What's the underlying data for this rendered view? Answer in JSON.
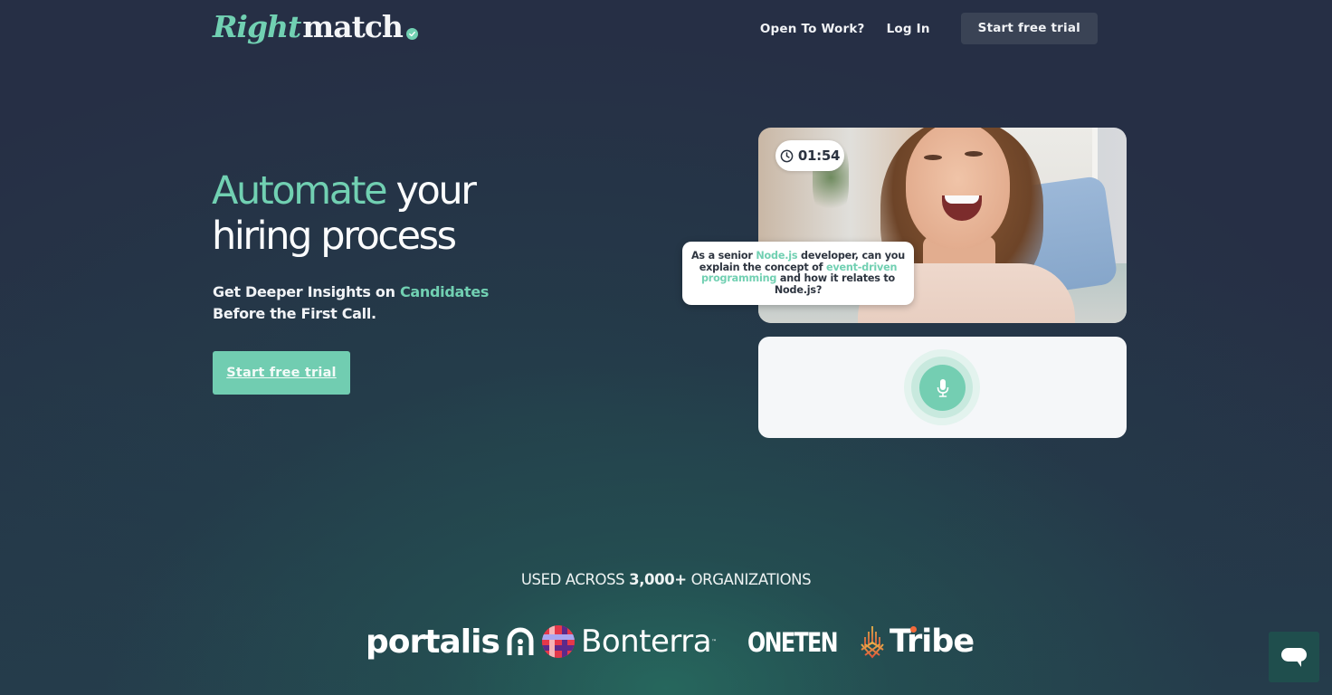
{
  "brand": {
    "logo_part1": "Right",
    "logo_part2": "match",
    "accent_color": "#71d0b2",
    "background_color": "#262f45"
  },
  "nav": {
    "open_to_work": "Open To Work?",
    "log_in": "Log In",
    "start_trial": "Start free trial"
  },
  "hero": {
    "headline_accent": "Automate",
    "headline_rest_line1": " your",
    "headline_line2": "hiring process",
    "sub_part1": "Get Deeper Insights on ",
    "sub_accent": "Candidates",
    "sub_part2": " Before the First Call.",
    "cta": "Start free trial"
  },
  "interview_demo": {
    "timer": "01:54",
    "timer_icon": "clock-icon",
    "question_part1": "As a senior ",
    "question_accent1": "Node.js",
    "question_part2": " developer, can you explain the concept of ",
    "question_accent2": "event-driven programming",
    "question_part3": " and how it relates to Node.js?",
    "mic_icon": "microphone-icon"
  },
  "social_proof": {
    "prefix": "USED ACROSS ",
    "count": "3,000+",
    "suffix": " ORGANIZATIONS",
    "logos": [
      {
        "name": "portalis"
      },
      {
        "name": "Bonterra"
      },
      {
        "name": "ONETEN"
      },
      {
        "name": "Tribe"
      }
    ]
  },
  "chat_widget": {
    "icon": "chat-bubble-icon"
  }
}
